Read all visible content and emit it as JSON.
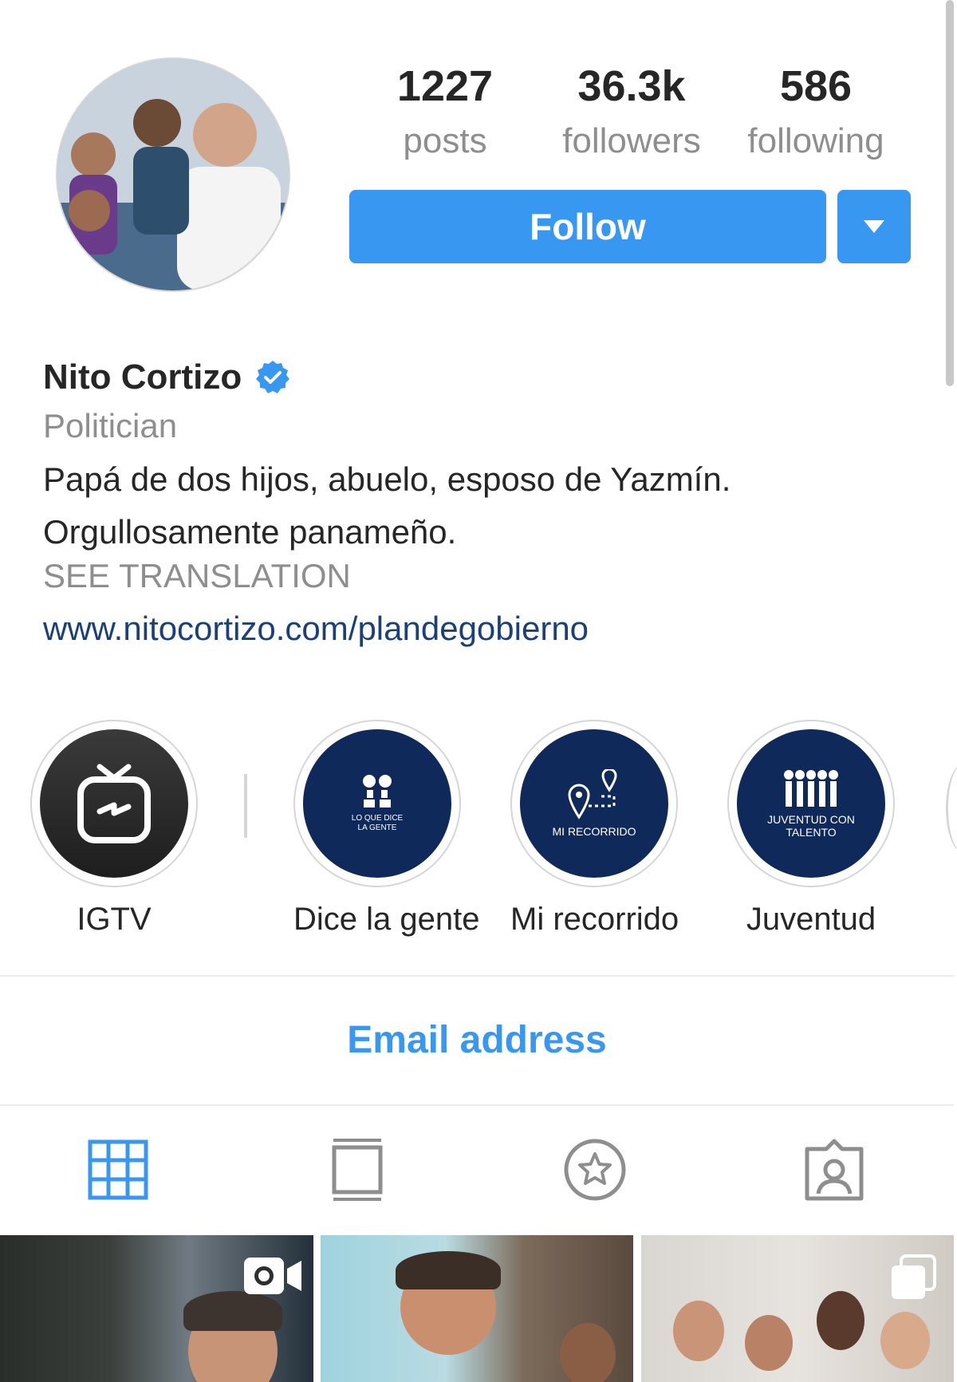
{
  "profile": {
    "name": "Nito Cortizo",
    "category": "Politician",
    "bio_line1": "Papá de dos hijos, abuelo, esposo de Yazmín.",
    "bio_line2": "Orgullosamente panameño.",
    "see_translation": "SEE TRANSLATION",
    "website": "www.nitocortizo.com/plandegobierno",
    "verified_icon": "verified-badge-icon"
  },
  "stats": {
    "posts": {
      "value": "1227",
      "label": "posts"
    },
    "followers": {
      "value": "36.3k",
      "label": "followers"
    },
    "following": {
      "value": "586",
      "label": "following"
    }
  },
  "actions": {
    "follow_label": "Follow",
    "dropdown_icon": "caret-down-icon"
  },
  "highlights": [
    {
      "label": "IGTV",
      "icon": "igtv-icon"
    },
    {
      "label": "Dice la gente",
      "caption": "LO QUE DICE LA GENTE",
      "icon": "people-speech-icon"
    },
    {
      "label": "Mi recorrido",
      "caption": "MI RECORRIDO",
      "icon": "route-pin-icon"
    },
    {
      "label": "Juventud",
      "caption": "JUVENTUD CON TALENTO",
      "icon": "youth-group-icon"
    }
  ],
  "contact": {
    "email_label": "Email address"
  },
  "tabs": [
    {
      "name": "grid",
      "icon": "grid-icon",
      "active": true
    },
    {
      "name": "feed",
      "icon": "feed-icon",
      "active": false
    },
    {
      "name": "saved",
      "icon": "star-circle-icon",
      "active": false
    },
    {
      "name": "tagged",
      "icon": "tagged-person-icon",
      "active": false
    }
  ],
  "colors": {
    "accent": "#3897f0",
    "text": "#262626",
    "muted": "#8e8e8e",
    "link": "#1b3f7a",
    "highlight_bg": "#0f2a5a"
  }
}
